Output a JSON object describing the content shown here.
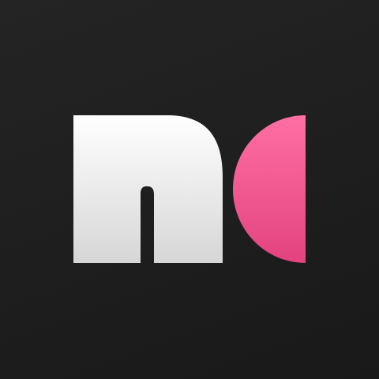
{
  "app": {
    "name": ""
  },
  "logo": {
    "icon": "nc-monogram-logo",
    "colors": {
      "background_top": "#242424",
      "background_bottom": "#191919",
      "letter_n_top": "#ffffff",
      "letter_n_bottom": "#d6d6d6",
      "half_disc_top": "#ff6fa3",
      "half_disc_bottom": "#e3437f"
    }
  }
}
